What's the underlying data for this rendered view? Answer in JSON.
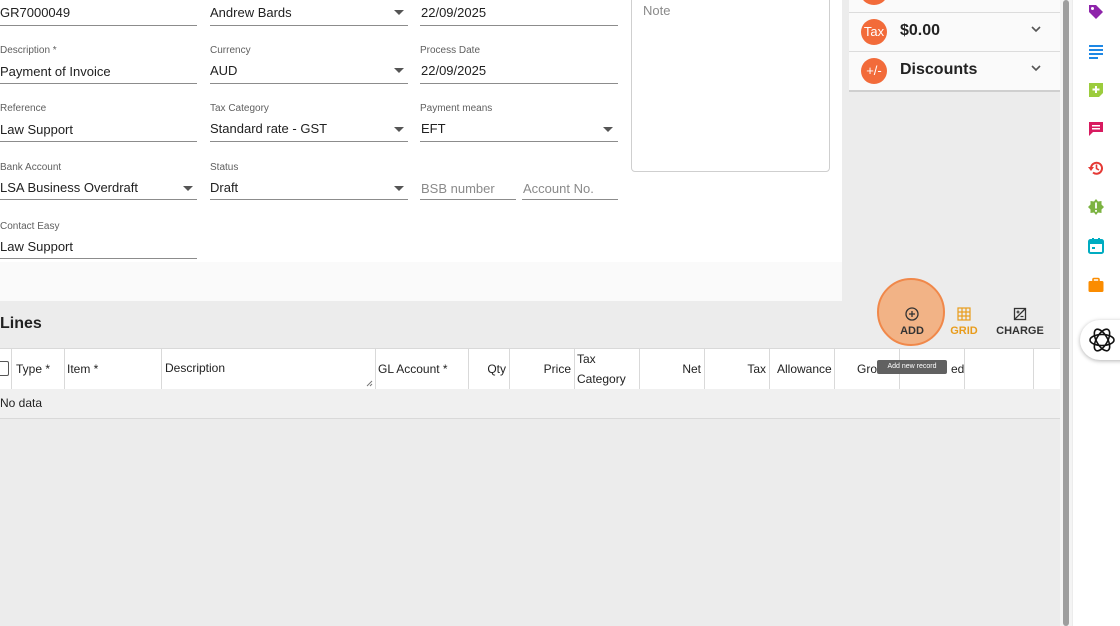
{
  "form": {
    "row1": {
      "invoice_number": "GR7000049",
      "contact": "Andrew Bards",
      "date": "22/09/2025"
    },
    "description": {
      "label": "Description *",
      "value": "Payment of Invoice"
    },
    "currency": {
      "label": "Currency",
      "value": "AUD"
    },
    "process_date": {
      "label": "Process Date",
      "value": "22/09/2025"
    },
    "reference": {
      "label": "Reference",
      "value": "Law Support"
    },
    "tax_category": {
      "label": "Tax Category",
      "value": "Standard rate - GST"
    },
    "payment_means": {
      "label": "Payment means",
      "value": "EFT"
    },
    "bank_account": {
      "label": "Bank Account",
      "value": "LSA Business Overdraft"
    },
    "status": {
      "label": "Status",
      "value": "Draft"
    },
    "bsb": {
      "placeholder": "BSB number"
    },
    "account_no": {
      "placeholder": "Account No."
    },
    "contact_easy": {
      "label": "Contact Easy",
      "value": "Law Support"
    },
    "note": {
      "placeholder": "Note"
    }
  },
  "summary": {
    "tax": {
      "badge": "Tax",
      "value": "$0.00"
    },
    "discounts": {
      "badge": "+/-",
      "label": "Discounts"
    }
  },
  "lines": {
    "title": "Lines",
    "toolbar": {
      "add": "ADD",
      "grid": "GRID",
      "charge": "CHARGE",
      "add_tooltip": "Add new record"
    },
    "columns": {
      "type": "Type *",
      "item": "Item *",
      "description": "Description",
      "gl_account": "GL Account *",
      "qty": "Qty",
      "price": "Price",
      "tax_category_1": "Tax",
      "tax_category_2": "Category",
      "net": "Net",
      "tax": "Tax",
      "allowance": "Allowance",
      "gross": "Gro",
      "extra": "ed"
    },
    "empty_text": "No data"
  },
  "colors": {
    "accent": "#f26b3a",
    "grid_active": "#e89c1c"
  },
  "rail_icons": [
    "tag-icon",
    "notes-icon",
    "add-note-icon",
    "comments-icon",
    "history-icon",
    "alert-icon",
    "calendar-icon",
    "briefcase-icon",
    "assistant-icon"
  ]
}
